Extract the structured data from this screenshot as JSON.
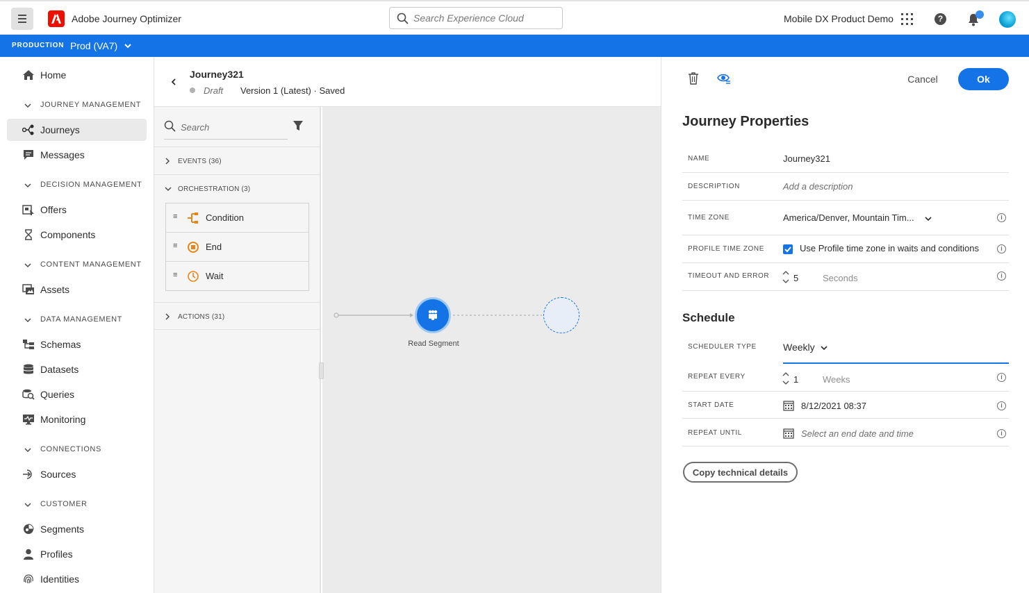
{
  "topbar": {
    "app_title": "Adobe Journey Optimizer",
    "search_placeholder": "Search Experience Cloud",
    "org_name": "Mobile DX Product Demo",
    "help_label": "?"
  },
  "envbar": {
    "label": "PRODUCTION",
    "sandbox": "Prod (VA7)"
  },
  "nav": {
    "home": "Home",
    "sections": {
      "journey_management": "JOURNEY MANAGEMENT",
      "decision_management": "DECISION MANAGEMENT",
      "content_management": "CONTENT MANAGEMENT",
      "data_management": "DATA MANAGEMENT",
      "connections": "CONNECTIONS",
      "customer": "CUSTOMER"
    },
    "items": {
      "journeys": "Journeys",
      "messages": "Messages",
      "offers": "Offers",
      "components": "Components",
      "assets": "Assets",
      "schemas": "Schemas",
      "datasets": "Datasets",
      "queries": "Queries",
      "monitoring": "Monitoring",
      "sources": "Sources",
      "segments": "Segments",
      "profiles": "Profiles",
      "identities": "Identities"
    },
    "active": "journeys"
  },
  "journey": {
    "name": "Journey321",
    "status": "Draft",
    "version": "Version 1 (Latest) · Saved"
  },
  "palette": {
    "search_placeholder": "Search",
    "events": "EVENTS (36)",
    "orchestration": "ORCHESTRATION (3)",
    "actions": "ACTIONS (31)",
    "orchestration_items": [
      "Condition",
      "End",
      "Wait"
    ],
    "grip": "≡"
  },
  "canvas": {
    "node_label": "Read Segment"
  },
  "properties": {
    "cancel": "Cancel",
    "ok": "Ok",
    "title": "Journey Properties",
    "name_label": "NAME",
    "name_value": "Journey321",
    "description_label": "DESCRIPTION",
    "description_placeholder": "Add a description",
    "timezone_label": "TIME ZONE",
    "timezone_value": "America/Denver, Mountain Tim...",
    "profile_tz_label": "PROFILE TIME ZONE",
    "profile_tz_text": "Use Profile time zone in waits and conditions",
    "profile_tz_checked": true,
    "timeout_label": "TIMEOUT AND ERROR",
    "timeout_value": "5",
    "timeout_unit": "Seconds",
    "info_glyph": "i"
  },
  "schedule": {
    "title": "Schedule",
    "type_label": "SCHEDULER TYPE",
    "type_value": "Weekly",
    "repeat_label": "REPEAT EVERY",
    "repeat_value": "1",
    "repeat_unit": "Weeks",
    "start_label": "START DATE",
    "start_value": "8/12/2021 08:37",
    "until_label": "REPEAT UNTIL",
    "until_placeholder": "Select an end date and time",
    "copy_button": "Copy technical details"
  },
  "colors": {
    "accent": "#1473e6",
    "adobe_red": "#eb1000",
    "orchestration_orange": "#e68619"
  }
}
